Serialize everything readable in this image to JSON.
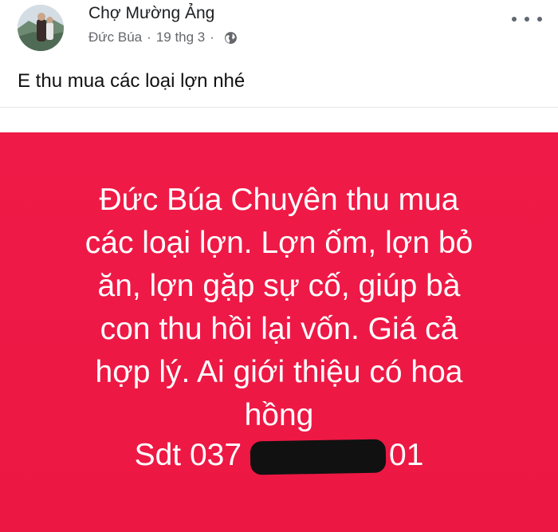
{
  "post": {
    "group_name": "Chợ Mường Ảng",
    "author": "Đức Búa",
    "separator": "·",
    "date": "19 thg 3",
    "privacy_icon": "globe-icon",
    "more_icon": "more-options-icon",
    "text": "E thu mua các loại lợn nhé"
  },
  "image_card": {
    "background_color": "#ee1845",
    "lines": [
      "Đức Búa Chuyên thu mua",
      "các loại lợn. Lợn ốm, lợn bỏ",
      "ăn, lợn gặp sự cố, giúp bà",
      "con thu hồi lại  vốn. Giá cả",
      "hợp lý. Ai giới thiệu có hoa",
      "hồng"
    ],
    "phone_label": "Sdt 037",
    "phone_end": "01"
  }
}
